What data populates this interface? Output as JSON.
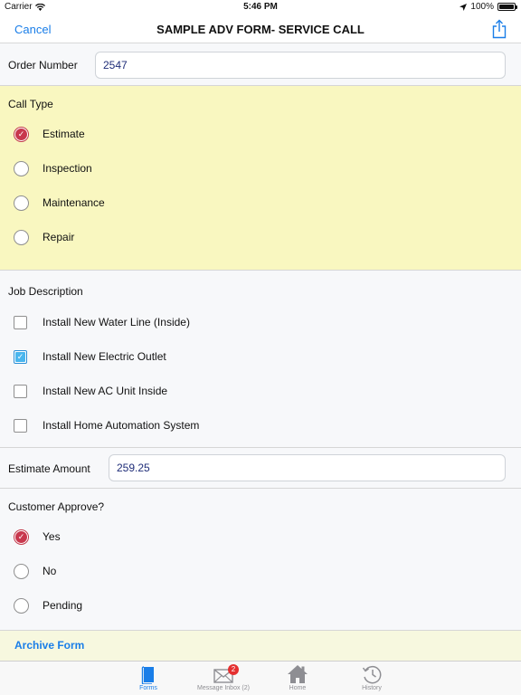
{
  "status_bar": {
    "carrier": "Carrier",
    "time": "5:46 PM",
    "battery": "100%",
    "battery_level": 1.0
  },
  "nav": {
    "cancel_label": "Cancel",
    "title": "SAMPLE ADV FORM- SERVICE CALL",
    "share_icon": "share-icon"
  },
  "form": {
    "order_number": {
      "label": "Order Number",
      "value": "2547"
    },
    "call_type": {
      "label": "Call Type",
      "options": [
        {
          "label": "Estimate",
          "selected": true
        },
        {
          "label": "Inspection",
          "selected": false
        },
        {
          "label": "Maintenance",
          "selected": false
        },
        {
          "label": "Repair",
          "selected": false
        }
      ]
    },
    "job_description": {
      "label": "Job Description",
      "options": [
        {
          "label": "Install New Water Line (Inside)",
          "checked": false
        },
        {
          "label": "Install New Electric Outlet",
          "checked": true
        },
        {
          "label": "Install New AC Unit Inside",
          "checked": false
        },
        {
          "label": "Install Home Automation System",
          "checked": false
        }
      ]
    },
    "estimate_amount": {
      "label": "Estimate Amount",
      "value": "259.25"
    },
    "customer_approve": {
      "label": "Customer Approve?",
      "options": [
        {
          "label": "Yes",
          "selected": true
        },
        {
          "label": "No",
          "selected": false
        },
        {
          "label": "Pending",
          "selected": false
        }
      ]
    },
    "archive_label": "Archive Form"
  },
  "tabs": [
    {
      "label": "Forms",
      "icon": "forms-icon",
      "active": true
    },
    {
      "label": "Message Inbox (2)",
      "icon": "envelope-icon",
      "active": false,
      "badge": "2"
    },
    {
      "label": "Home",
      "icon": "home-icon",
      "active": false
    },
    {
      "label": "History",
      "icon": "history-icon",
      "active": false
    }
  ],
  "colors": {
    "accent": "#1a7ee8",
    "highlight_section": "#f9f7c0",
    "radio_selected": "#c8374d",
    "checkbox_selected": "#4ab6ee",
    "badge": "#e53030"
  }
}
